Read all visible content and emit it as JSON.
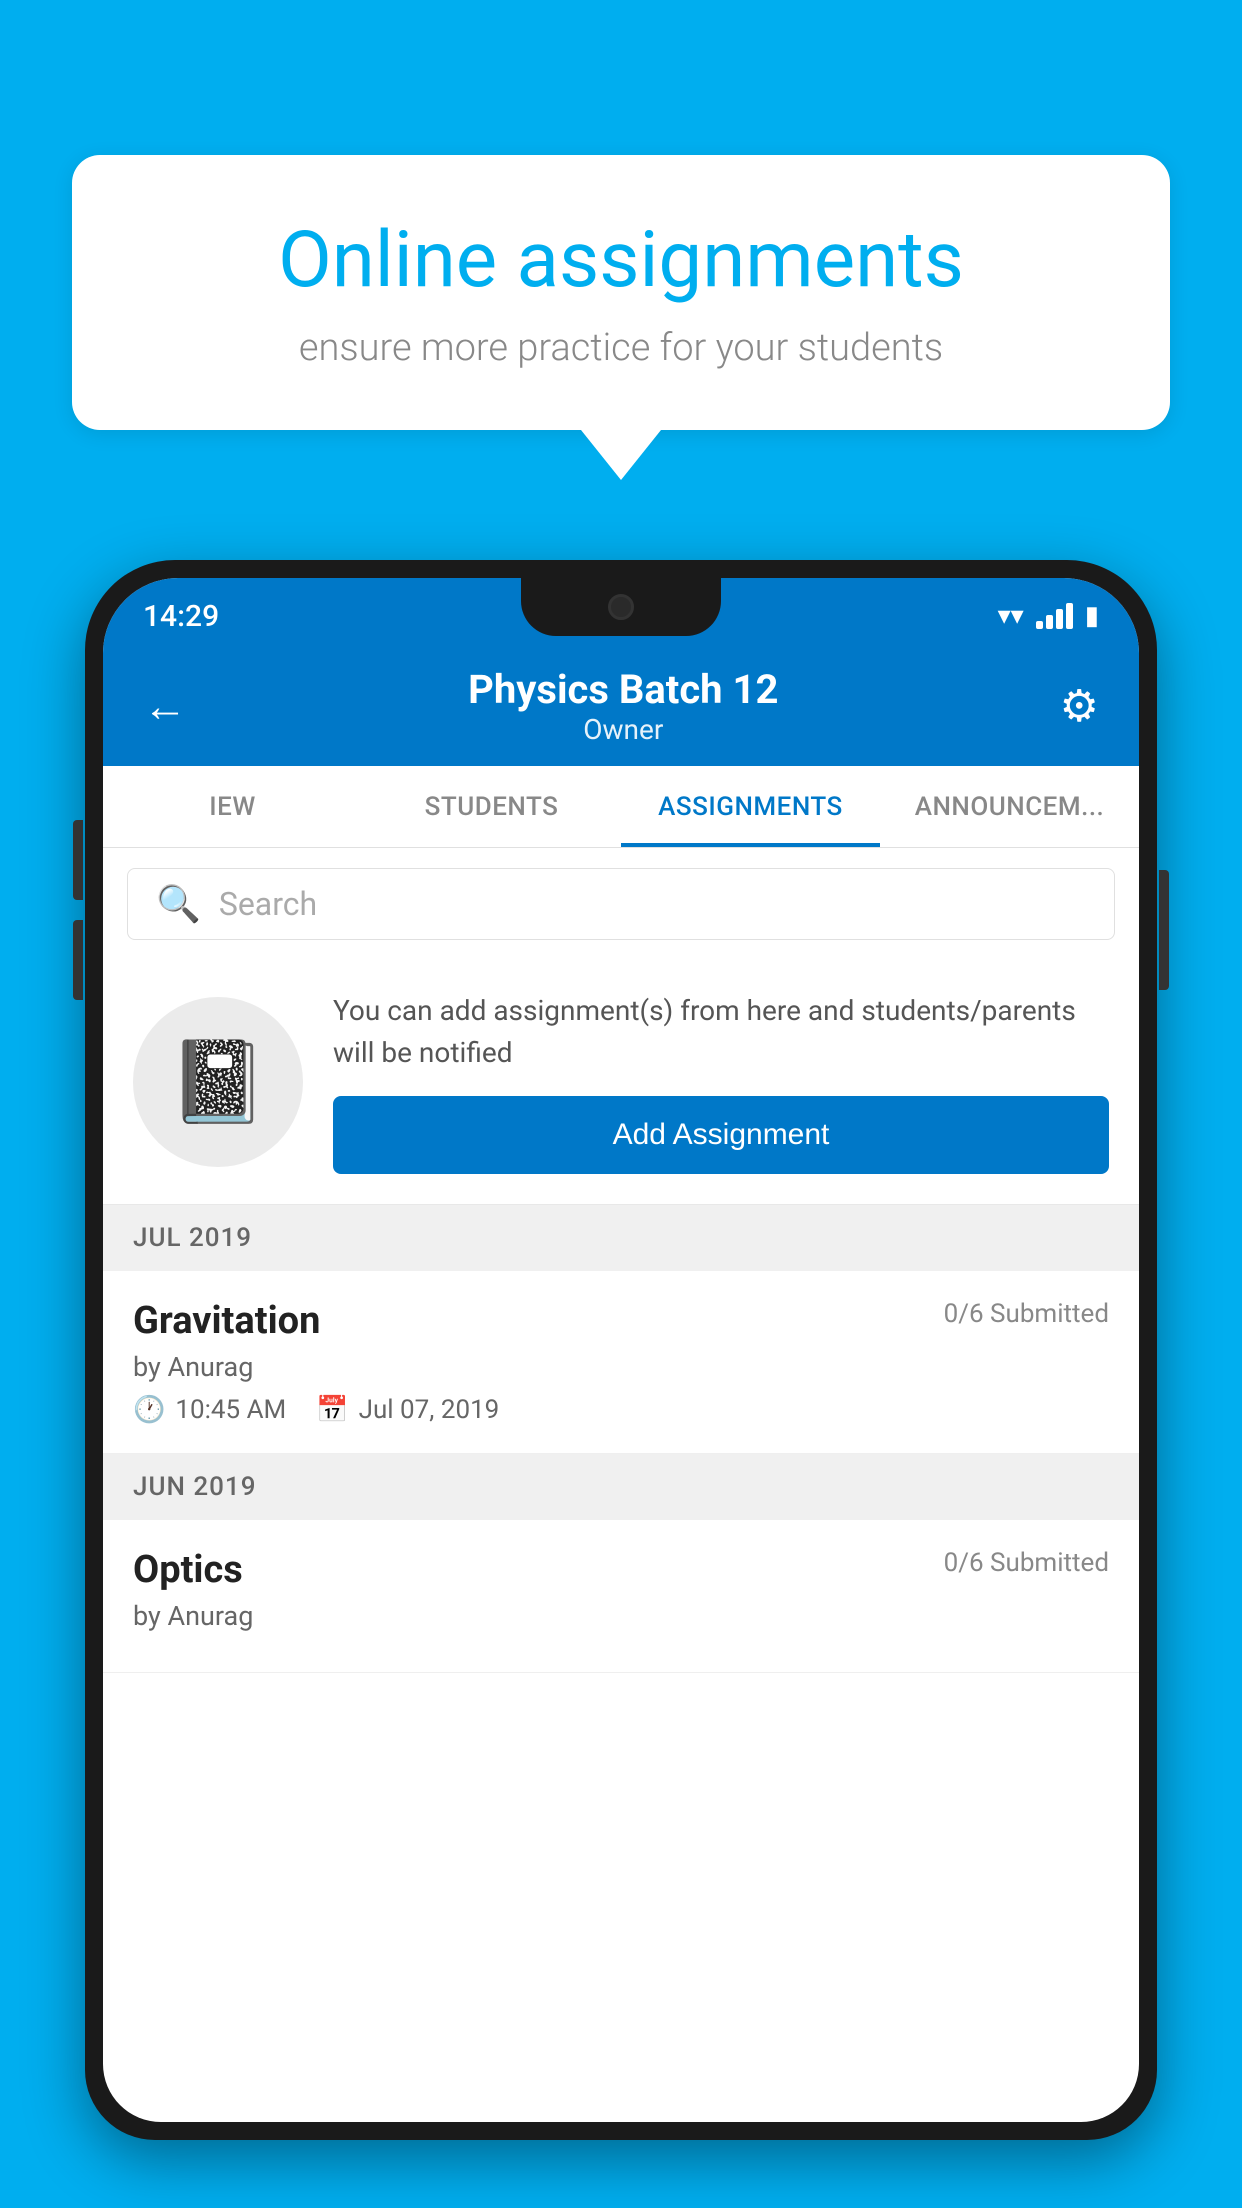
{
  "background_color": "#00AEEF",
  "speech_bubble": {
    "title": "Online assignments",
    "subtitle": "ensure more practice for your students"
  },
  "status_bar": {
    "time": "14:29"
  },
  "app_header": {
    "title": "Physics Batch 12",
    "subtitle": "Owner",
    "back_label": "←",
    "settings_label": "⚙"
  },
  "tabs": [
    {
      "label": "IEW",
      "active": false
    },
    {
      "label": "STUDENTS",
      "active": false
    },
    {
      "label": "ASSIGNMENTS",
      "active": true
    },
    {
      "label": "ANNOUNCEM...",
      "active": false
    }
  ],
  "search": {
    "placeholder": "Search"
  },
  "info_card": {
    "description": "You can add assignment(s) from here and students/parents will be notified",
    "button_label": "Add Assignment"
  },
  "assignments": [
    {
      "month_label": "JUL 2019",
      "items": [
        {
          "name": "Gravitation",
          "submitted": "0/6 Submitted",
          "author": "by Anurag",
          "time": "10:45 AM",
          "date": "Jul 07, 2019"
        }
      ]
    },
    {
      "month_label": "JUN 2019",
      "items": [
        {
          "name": "Optics",
          "submitted": "0/6 Submitted",
          "author": "by Anurag",
          "time": "",
          "date": ""
        }
      ]
    }
  ]
}
